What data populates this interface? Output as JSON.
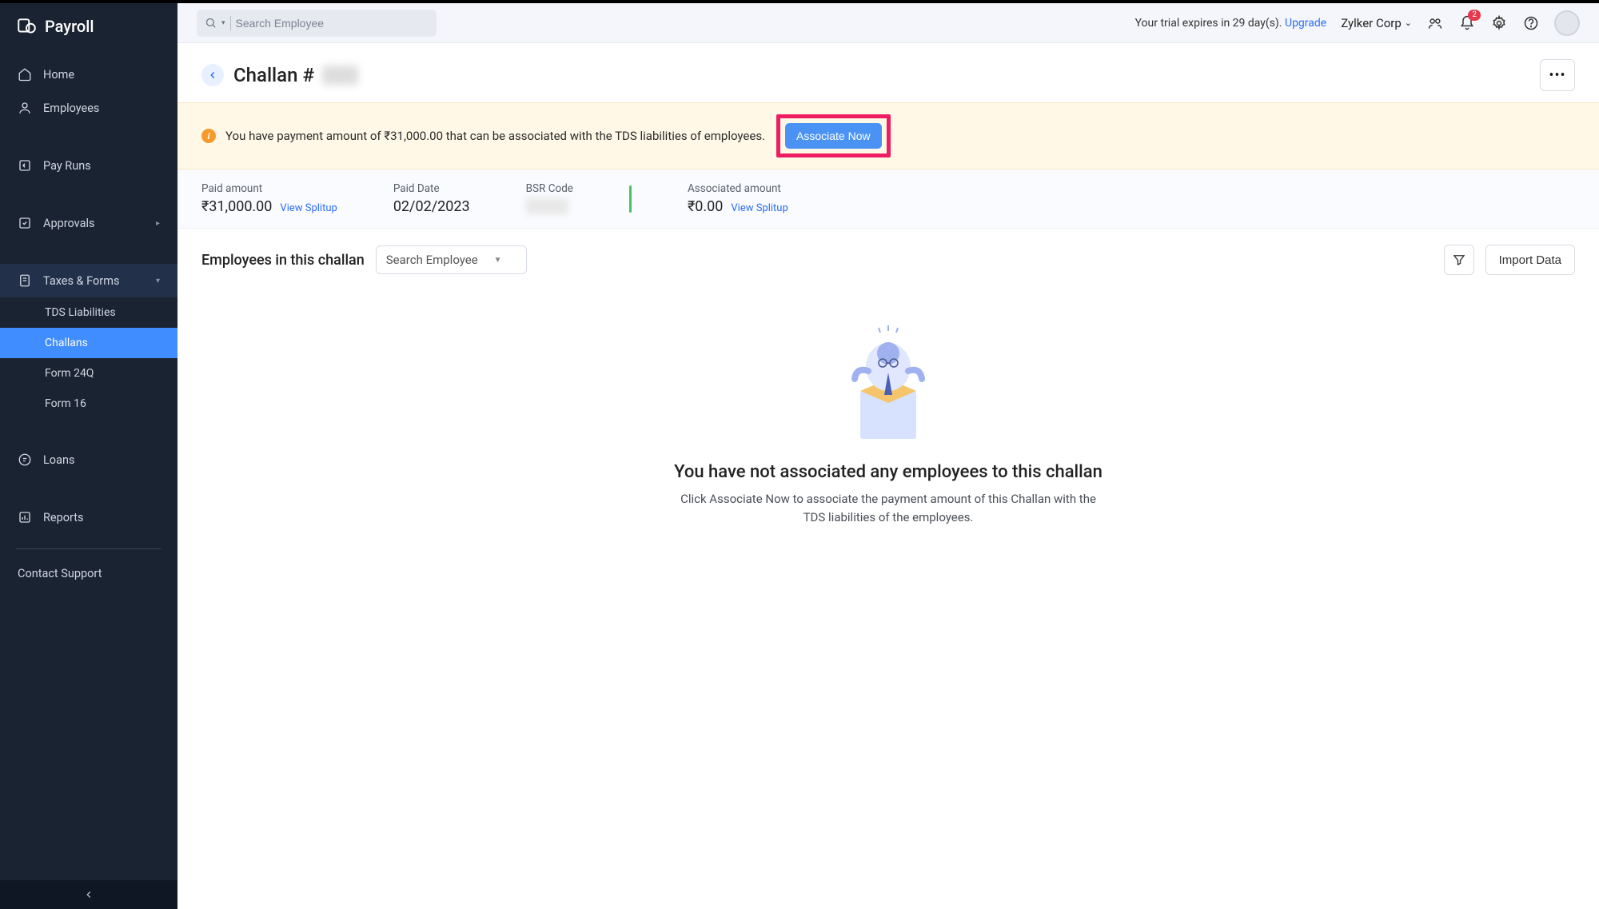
{
  "app_name": "Payroll",
  "sidebar": {
    "items": [
      {
        "label": "Home"
      },
      {
        "label": "Employees"
      },
      {
        "label": "Pay Runs"
      },
      {
        "label": "Approvals"
      },
      {
        "label": "Taxes & Forms"
      },
      {
        "label": "Loans"
      },
      {
        "label": "Reports"
      }
    ],
    "taxes_sub": [
      {
        "label": "TDS Liabilities"
      },
      {
        "label": "Challans"
      },
      {
        "label": "Form 24Q"
      },
      {
        "label": "Form 16"
      }
    ],
    "contact": "Contact Support"
  },
  "topbar": {
    "search_placeholder": "Search Employee",
    "trial_prefix": "Your trial expires in 29 day(s). ",
    "upgrade": "Upgrade",
    "org": "Zylker Corp",
    "notif_count": "2"
  },
  "page": {
    "title": "Challan #",
    "hidden_id": "—"
  },
  "banner": {
    "text": "You have payment amount of ₹31,000.00 that can be associated with the TDS liabilities of employees.",
    "button": "Associate Now"
  },
  "stats": {
    "paid_amount_label": "Paid amount",
    "paid_amount_value": "₹31,000.00",
    "view_splitup": "View Splitup",
    "paid_date_label": "Paid Date",
    "paid_date_value": "02/02/2023",
    "bsr_label": "BSR Code",
    "bsr_value": "—",
    "assoc_label": "Associated amount",
    "assoc_value": "₹0.00"
  },
  "section": {
    "title": "Employees in this challan",
    "search_placeholder": "Search Employee",
    "import": "Import Data"
  },
  "empty": {
    "title": "You have not associated any employees to this challan",
    "desc": "Click Associate Now to associate the payment amount of this Challan with the TDS liabilities of the employees."
  }
}
